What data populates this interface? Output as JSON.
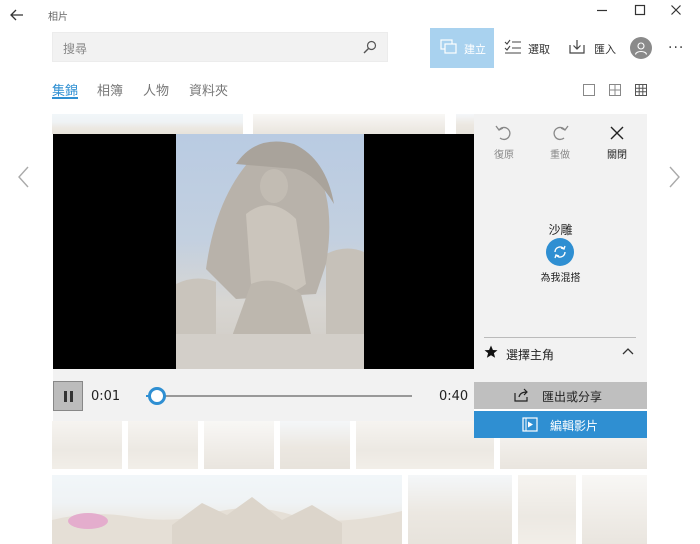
{
  "window": {
    "title": "相片"
  },
  "search": {
    "placeholder": "搜尋"
  },
  "toolbar": {
    "create_label": "建立",
    "select_label": "選取",
    "import_label": "匯入"
  },
  "nav": {
    "tabs": [
      "集錦",
      "相簿",
      "人物",
      "資料夾"
    ],
    "active": 0
  },
  "player": {
    "current_time": "0:01",
    "total_time": "0:40",
    "progress": 0.04
  },
  "edit_panel": {
    "undo_label": "復原",
    "redo_label": "重做",
    "close_label": "關閉",
    "theme_name": "沙雕",
    "remix_label": "為我混搭",
    "choose_lead_label": "選擇主角"
  },
  "actions": {
    "export_label": "匯出或分享",
    "edit_video_label": "編輯影片"
  },
  "colors": {
    "accent": "#2f8fd2",
    "create_bg": "#a9d2ef",
    "panel_bg": "#f2f2f2"
  },
  "icons": [
    "back-arrow-icon",
    "minimize-icon",
    "maximize-icon",
    "close-icon",
    "search-icon",
    "create-icon",
    "select-icon",
    "import-icon",
    "person-icon",
    "undo-icon",
    "redo-icon",
    "remix-icon",
    "star-icon",
    "chevron-up-icon",
    "share-icon",
    "edit-video-icon"
  ]
}
